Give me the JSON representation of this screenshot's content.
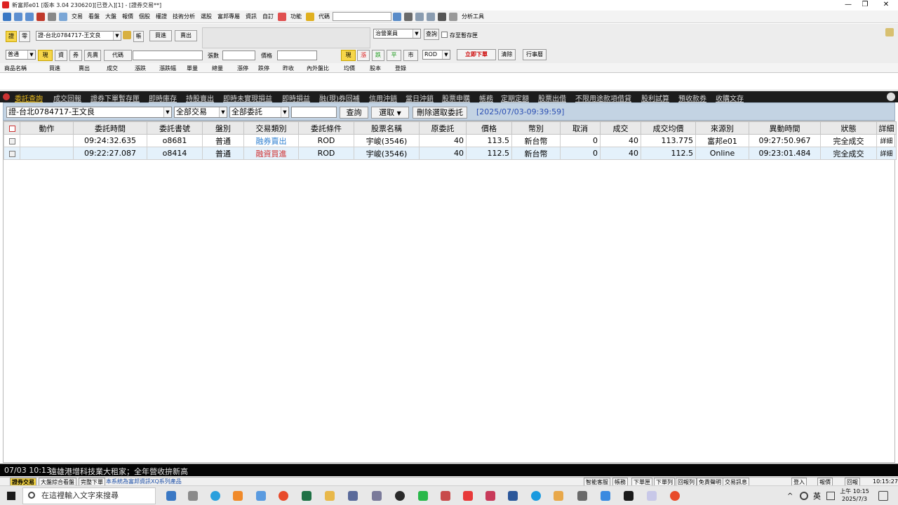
{
  "window": {
    "title": "新富邦e01 [版本 3.04 230620][已登入][1] - [證券交易**]",
    "controls": [
      "—",
      "❐",
      "✕"
    ]
  },
  "menu": {
    "items": [
      "交易",
      "看盤",
      "大盤",
      "報價",
      "個股",
      "權證",
      "技術分析",
      "選股",
      "富邦專屬",
      "資訊",
      "自訂",
      "功能"
    ],
    "code_label": "代碼",
    "analysis_tools": "分析工具"
  },
  "order_panel": {
    "mode_buttons": [
      "證",
      "零"
    ],
    "account": "證-台北0784717-王文良",
    "account_btn": "帳",
    "buy_sell_buttons": [
      "買進",
      "賣出"
    ],
    "agent_select": "治營業員",
    "query_btn": "查詢",
    "save_checkbox": "存至暫存匣",
    "order_type": "普通",
    "trade_buttons": [
      "現",
      "資",
      "券",
      "先賣"
    ],
    "code_btn": "代碼",
    "qty_label": "張數",
    "price_label": "價格",
    "price_type_buttons": [
      "現",
      "漲",
      "跌",
      "平",
      "市"
    ],
    "rod_select": "ROD",
    "place_order_btn": "立即下單",
    "clear_btn": "清除",
    "calendar_btn": "行事曆"
  },
  "quote_header": [
    "商品名稱",
    "買進",
    "賣出",
    "成交",
    "漲跌",
    "漲跌幅",
    "單量",
    "總量",
    "漲停",
    "跌停",
    "昨收",
    "內外盤比",
    "均價",
    "股本",
    "登錄"
  ],
  "tabs": [
    "委託查詢",
    "成交回報",
    "證券下單暫存匣",
    "即時庫存",
    "持股賣出",
    "即時未實現損益",
    "即時損益",
    "融(現)券回補",
    "信用沖銷",
    "當日沖銷",
    "股票申購",
    "帳務",
    "定期定額",
    "股票出借",
    "不限用途款項借貸",
    "股利試算",
    "預收款券",
    "收購文存"
  ],
  "filter": {
    "account": "證-台北0784717-王文良",
    "trade_type": "全部交易",
    "order_status": "全部委託",
    "search_value": "",
    "query_btn": "查詢",
    "select_btn": "選取",
    "delete_btn": "刪除選取委託",
    "timestamp": "[2025/07/03-09:39:59]"
  },
  "grid": {
    "columns": [
      "",
      "動作",
      "委託時間",
      "委託書號",
      "盤別",
      "交易類別",
      "委託條件",
      "股票名稱",
      "原委託",
      "價格",
      "幣別",
      "取消",
      "成交",
      "成交均價",
      "來源別",
      "異動時間",
      "狀態",
      "詳細"
    ],
    "rows": [
      {
        "action": "",
        "order_time": "09:24:32.635",
        "order_no": "o8681",
        "session": "普通",
        "trade_type": "融券賣出",
        "trade_color": "#2f7fd0",
        "condition": "ROD",
        "stock": "宇峻(3546)",
        "orig_qty": "40",
        "price": "113.5",
        "currency": "新台幣",
        "cancel": "0",
        "filled": "40",
        "avg_price": "113.775",
        "source": "富邦e01",
        "update_time": "09:27:50.967",
        "status": "完全成交",
        "detail": "詳細"
      },
      {
        "action": "",
        "order_time": "09:22:27.087",
        "order_no": "o8414",
        "session": "普通",
        "trade_type": "融資買進",
        "trade_color": "#d03030",
        "condition": "ROD",
        "stock": "宇峻(3546)",
        "orig_qty": "40",
        "price": "112.5",
        "currency": "新台幣",
        "cancel": "0",
        "filled": "40",
        "avg_price": "112.5",
        "source": "Online",
        "update_time": "09:23:01.484",
        "status": "完全成交",
        "detail": "詳細"
      }
    ]
  },
  "ticker": {
    "datetime": "07/03 10:13",
    "headline": "遠雄港增科技業大租家；全年營收拚新高"
  },
  "status_bar": {
    "left_items": [
      "證券交易",
      "大盤綜合看盤",
      "完整下單"
    ],
    "notice": "本系統為富邦資訊XQ系列產品",
    "right_items": [
      "智能客服",
      "帳務",
      "下單匣",
      "下單列",
      "回報列",
      "免責聲明",
      "交易訊息",
      "登入",
      "報價",
      "回報"
    ],
    "clock": "10:15:27"
  },
  "taskbar": {
    "search_placeholder": "在這裡輸入文字來搜尋",
    "ime": "英",
    "time": "上午 10:15",
    "date": "2025/7/3"
  }
}
